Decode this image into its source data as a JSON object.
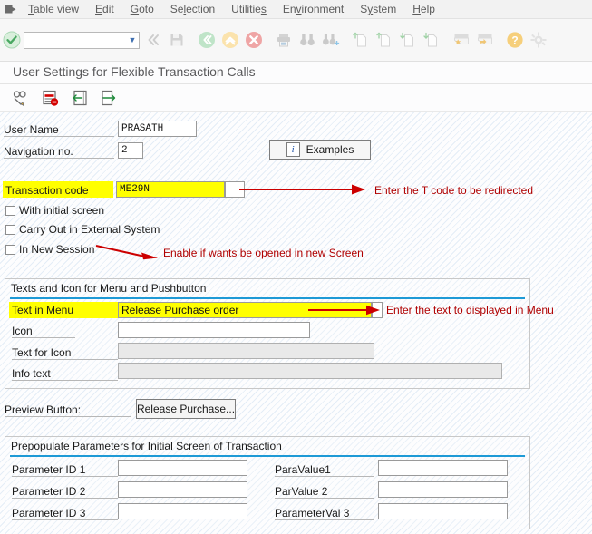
{
  "window": {
    "title": "User Settings for Flexible Transaction Calls"
  },
  "menubar": {
    "system_icon": "system-menu-icon",
    "items": [
      {
        "label": "Table view"
      },
      {
        "label": "Edit"
      },
      {
        "label": "Goto"
      },
      {
        "label": "Selection"
      },
      {
        "label": "Utilities"
      },
      {
        "label": "Environment"
      },
      {
        "label": "System"
      },
      {
        "label": "Help"
      }
    ]
  },
  "toolbar": {
    "command_field_value": "",
    "command_field_placeholder": "",
    "buttons": [
      {
        "name": "enter-check-icon",
        "title": "Enter"
      },
      {
        "name": "back-double-left-icon",
        "title": "Back"
      },
      {
        "name": "save-disk-icon",
        "title": "Save"
      },
      {
        "name": "back-green-icon",
        "title": "Back"
      },
      {
        "name": "exit-up-icon",
        "title": "Exit"
      },
      {
        "name": "cancel-x-icon",
        "title": "Cancel"
      },
      {
        "name": "print-icon",
        "title": "Print"
      },
      {
        "name": "find-binoculars-icon",
        "title": "Find"
      },
      {
        "name": "find-next-binoculars-icon",
        "title": "Find Next"
      },
      {
        "name": "first-page-icon",
        "title": "First Page"
      },
      {
        "name": "previous-page-icon",
        "title": "Previous Page"
      },
      {
        "name": "next-page-icon",
        "title": "Next Page"
      },
      {
        "name": "last-page-icon",
        "title": "Last Page"
      },
      {
        "name": "create-session-icon",
        "title": "Create New Session"
      },
      {
        "name": "create-shortcut-icon",
        "title": "Create Shortcut"
      },
      {
        "name": "help-question-icon",
        "title": "Help"
      },
      {
        "name": "customize-gear-icon",
        "title": "Customize Local Layout"
      }
    ]
  },
  "apptoolbar": {
    "buttons": [
      {
        "name": "display-change-icon",
        "title": "Display/Change"
      },
      {
        "name": "delete-row-icon",
        "title": "Delete Entry"
      },
      {
        "name": "previous-entry-icon",
        "title": "Previous Entry"
      },
      {
        "name": "next-entry-icon",
        "title": "Next Entry"
      }
    ]
  },
  "form": {
    "user_name": {
      "label": "User Name",
      "value": "PRASATH"
    },
    "navigation_no": {
      "label": "Navigation no.",
      "value": "2"
    },
    "examples_button": {
      "label": "Examples",
      "icon": "info-i-icon"
    },
    "transaction_code": {
      "label": "Transaction code",
      "value": "ME29N"
    },
    "checkboxes": [
      {
        "label": "With initial screen",
        "checked": false
      },
      {
        "label": "Carry Out in External System",
        "checked": false
      },
      {
        "label": "In New Session",
        "checked": false
      }
    ]
  },
  "texts_group": {
    "title": "Texts and Icon for Menu and Pushbutton",
    "rows": [
      {
        "label": "Text in Menu",
        "value": "Release Purchase order",
        "state": "highlight"
      },
      {
        "label": "Icon",
        "value": "",
        "state": "enabled"
      },
      {
        "label": "Text for Icon",
        "value": "",
        "state": "disabled"
      },
      {
        "label": "Info text",
        "value": "",
        "state": "disabled"
      }
    ]
  },
  "preview": {
    "label": "Preview Button:",
    "button_label": "Release Purchase..."
  },
  "params_group": {
    "title": "Prepopulate Parameters for Initial Screen of Transaction",
    "rows": [
      {
        "id_label": "Parameter ID 1",
        "id_value": "",
        "val_label": "ParaValue1",
        "val_value": ""
      },
      {
        "id_label": "Parameter ID 2",
        "id_value": "",
        "val_label": "ParValue 2",
        "val_value": ""
      },
      {
        "id_label": "Parameter ID 3",
        "id_value": "",
        "val_label": "ParameterVal 3",
        "val_value": ""
      }
    ]
  },
  "annotations": [
    {
      "text": "Enter the T code to be redirected"
    },
    {
      "text": "Enable if wants be opened in new Screen"
    },
    {
      "text": "Enter the text to displayed in Menu"
    }
  ],
  "colors": {
    "highlight": "#ffff00",
    "annotation": "#b00000",
    "group_rule": "#1e9ad6",
    "menu_text": "#5c5c5c"
  }
}
